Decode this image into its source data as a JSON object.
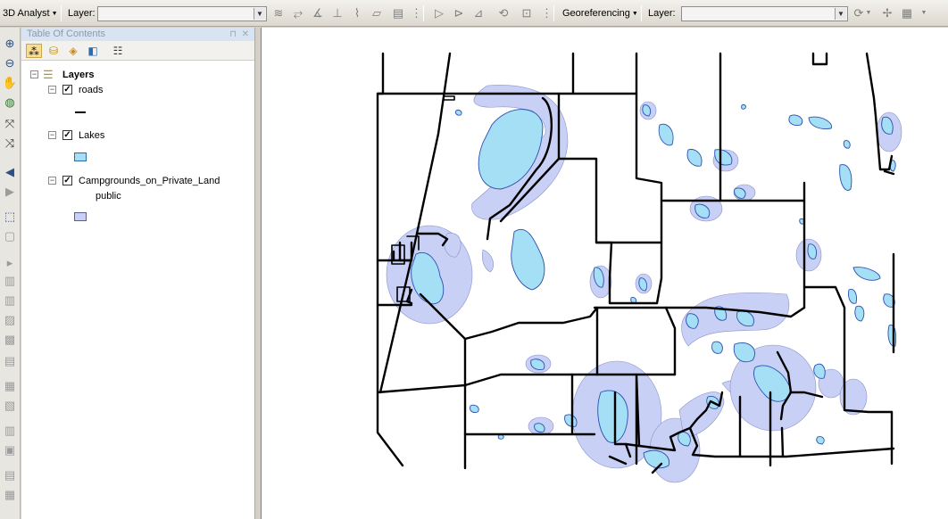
{
  "toolbar": {
    "analyst_label": "3D Analyst",
    "layer_label_1": "Layer:",
    "layer_value_1": "",
    "georef_label": "Georeferencing",
    "layer_label_2": "Layer:",
    "layer_value_2": ""
  },
  "toc": {
    "title": "Table Of Contents",
    "root_label": "Layers",
    "layers": [
      {
        "name": "roads",
        "visible": true
      },
      {
        "name": "Lakes",
        "visible": true,
        "swatch_color": "#a6def6"
      },
      {
        "name": "Campgrounds_on_Private_Land",
        "visible": true,
        "sublabel": "public",
        "swatch_color": "#c9d0f5"
      }
    ]
  },
  "map": {
    "lake_color": "#a5dff5",
    "buffer_color": "#c9d0f5",
    "outline_color": "#2a4fb0",
    "road_color": "#000000"
  }
}
